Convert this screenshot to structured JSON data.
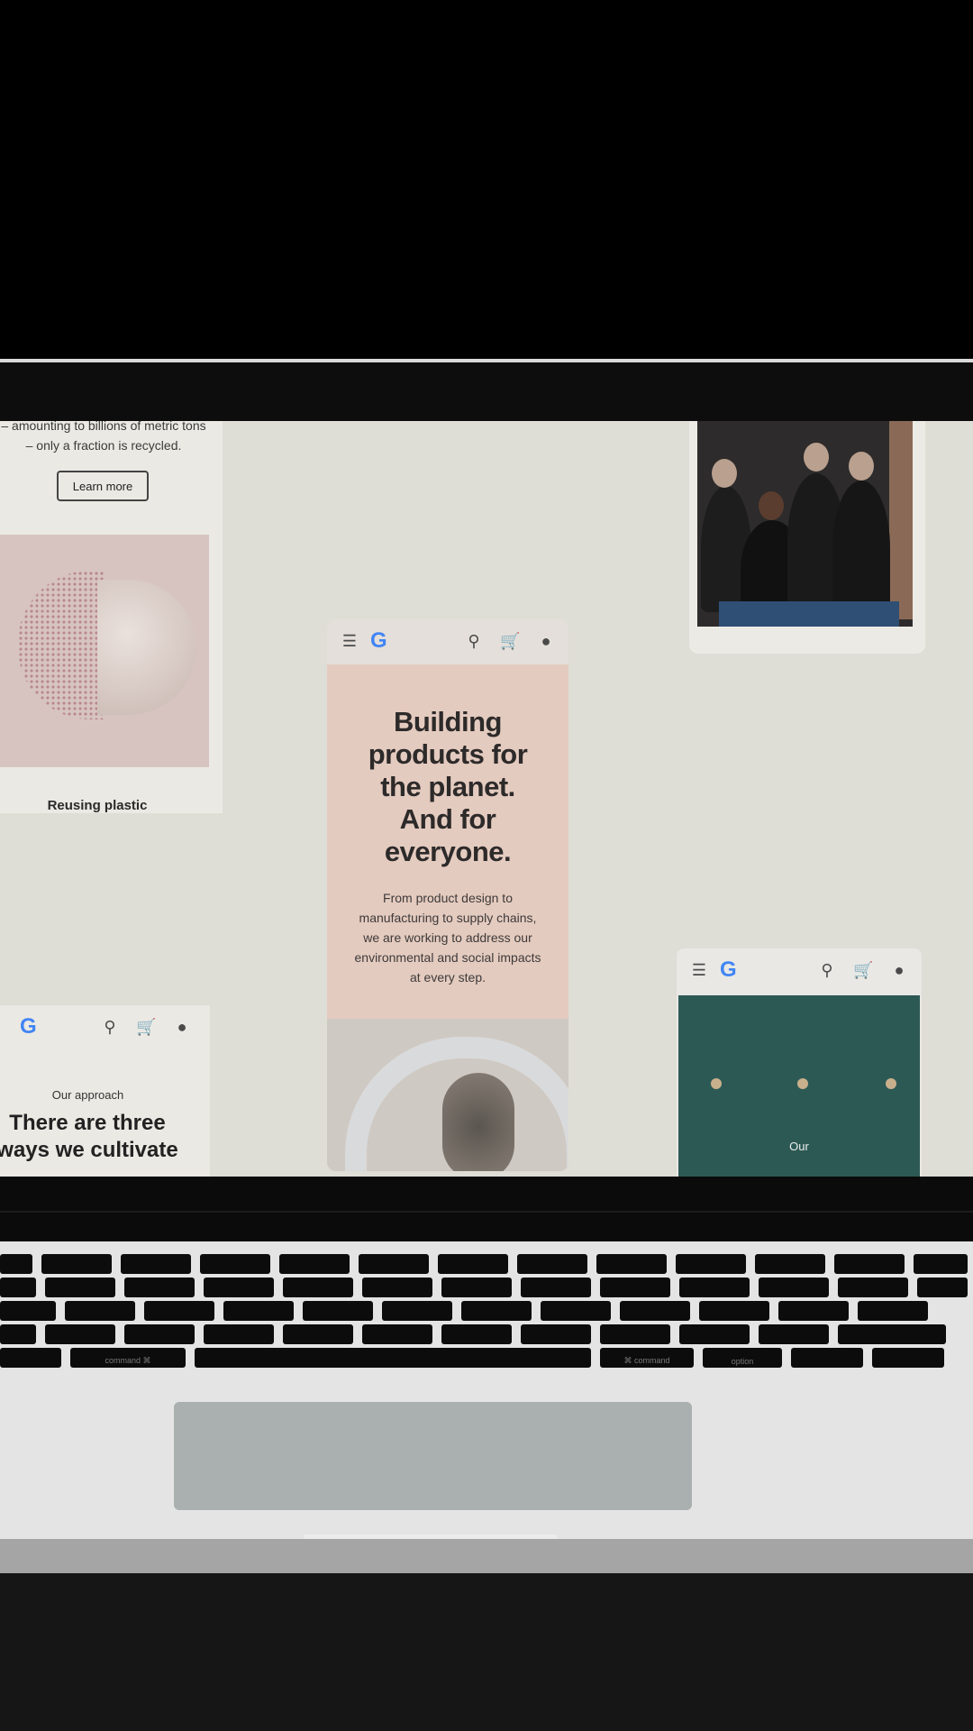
{
  "screen": {
    "card_left_top": {
      "copy_line1": "– amounting to billions of metric tons",
      "copy_line2": "– only a fraction is recycled.",
      "learn_more": "Learn more",
      "reusing_caption": "Reusing plastic"
    },
    "card_center": {
      "headline_line1": "Building",
      "headline_line2": "products for",
      "headline_line3": "the planet.",
      "headline_line4": "And for",
      "headline_line5": "everyone.",
      "sub_line1": "From product design to",
      "sub_line2": "manufacturing to supply chains,",
      "sub_line3": "we are working to address our",
      "sub_line4": "environmental and social impacts",
      "sub_line5": "at every step."
    },
    "card_left_bottom": {
      "eyebrow": "Our approach",
      "title_line1": "There are three",
      "title_line2": "ways we cultivate"
    },
    "card_right_bottom": {
      "eyebrow": "Our"
    }
  },
  "icons": [
    "menu-icon",
    "google-logo",
    "search-icon",
    "cart-icon",
    "account-icon"
  ],
  "colors": {
    "screen_bg": "#deddd6",
    "center_card_bg": "#e4cbbf",
    "teal_card_bg": "#2d5955",
    "trackpad": "#aab0b0"
  },
  "keyboard": {
    "labels": [
      "command ⌘",
      "⌘ command",
      "option"
    ]
  }
}
